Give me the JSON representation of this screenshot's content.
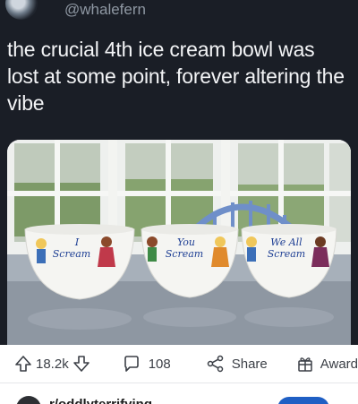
{
  "tweet": {
    "handle": "@whalefern",
    "text": "the crucial 4th ice cream bowl was lost at some point, forever altering the vibe",
    "bowls": [
      {
        "line1": "I",
        "line2": "Scream"
      },
      {
        "line1": "You",
        "line2": "Scream"
      },
      {
        "line1": "We All",
        "line2": "Scream"
      }
    ]
  },
  "actions": {
    "upvotes": "18.2k",
    "comments": "108",
    "share_label": "Share",
    "award_label": "Award"
  },
  "next_post": {
    "subreddit": "r/oddlyterrifying"
  },
  "colors": {
    "card_bg": "#1a1e26",
    "bowl_text": "#1e3f94",
    "join_button": "#1f5fc4"
  }
}
